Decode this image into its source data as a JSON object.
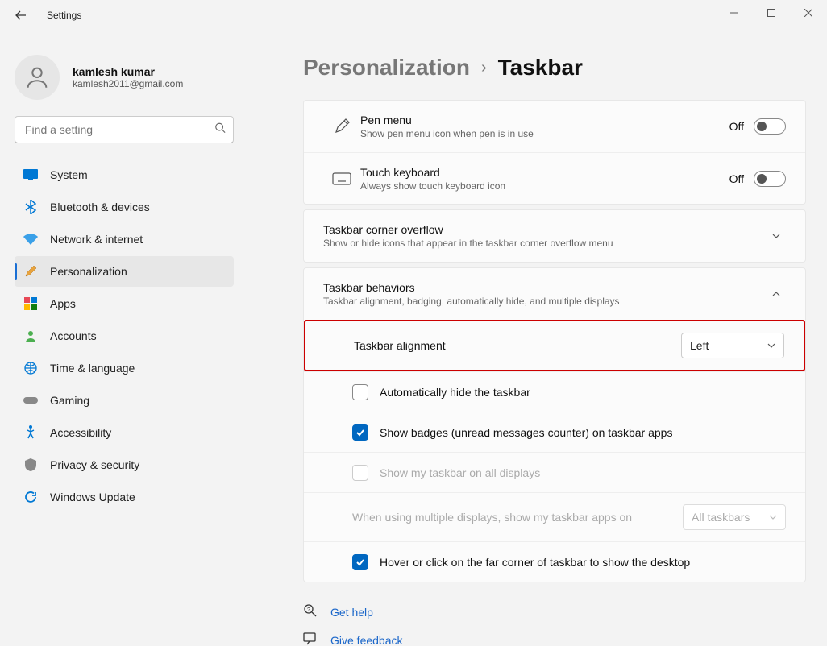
{
  "app": {
    "title": "Settings"
  },
  "user": {
    "name": "kamlesh kumar",
    "email": "kamlesh2011@gmail.com"
  },
  "search": {
    "placeholder": "Find a setting"
  },
  "nav": {
    "system": "System",
    "bluetooth": "Bluetooth & devices",
    "network": "Network & internet",
    "personalization": "Personalization",
    "apps": "Apps",
    "accounts": "Accounts",
    "time": "Time & language",
    "gaming": "Gaming",
    "accessibility": "Accessibility",
    "privacy": "Privacy & security",
    "update": "Windows Update"
  },
  "breadcrumb": {
    "parent": "Personalization",
    "current": "Taskbar"
  },
  "pen": {
    "title": "Pen menu",
    "desc": "Show pen menu icon when pen is in use",
    "state": "Off"
  },
  "touchkb": {
    "title": "Touch keyboard",
    "desc": "Always show touch keyboard icon",
    "state": "Off"
  },
  "overflow": {
    "title": "Taskbar corner overflow",
    "desc": "Show or hide icons that appear in the taskbar corner overflow menu"
  },
  "behaviors": {
    "title": "Taskbar behaviors",
    "desc": "Taskbar alignment, badging, automatically hide, and multiple displays"
  },
  "alignment": {
    "label": "Taskbar alignment",
    "value": "Left"
  },
  "autohide": {
    "label": "Automatically hide the taskbar"
  },
  "badges": {
    "label": "Show badges (unread messages counter) on taskbar apps"
  },
  "allDisplays": {
    "label": "Show my taskbar on all displays"
  },
  "multi": {
    "label": "When using multiple displays, show my taskbar apps on",
    "value": "All taskbars"
  },
  "hover": {
    "label": "Hover or click on the far corner of taskbar to show the desktop"
  },
  "footer": {
    "help": "Get help",
    "feedback": "Give feedback"
  }
}
